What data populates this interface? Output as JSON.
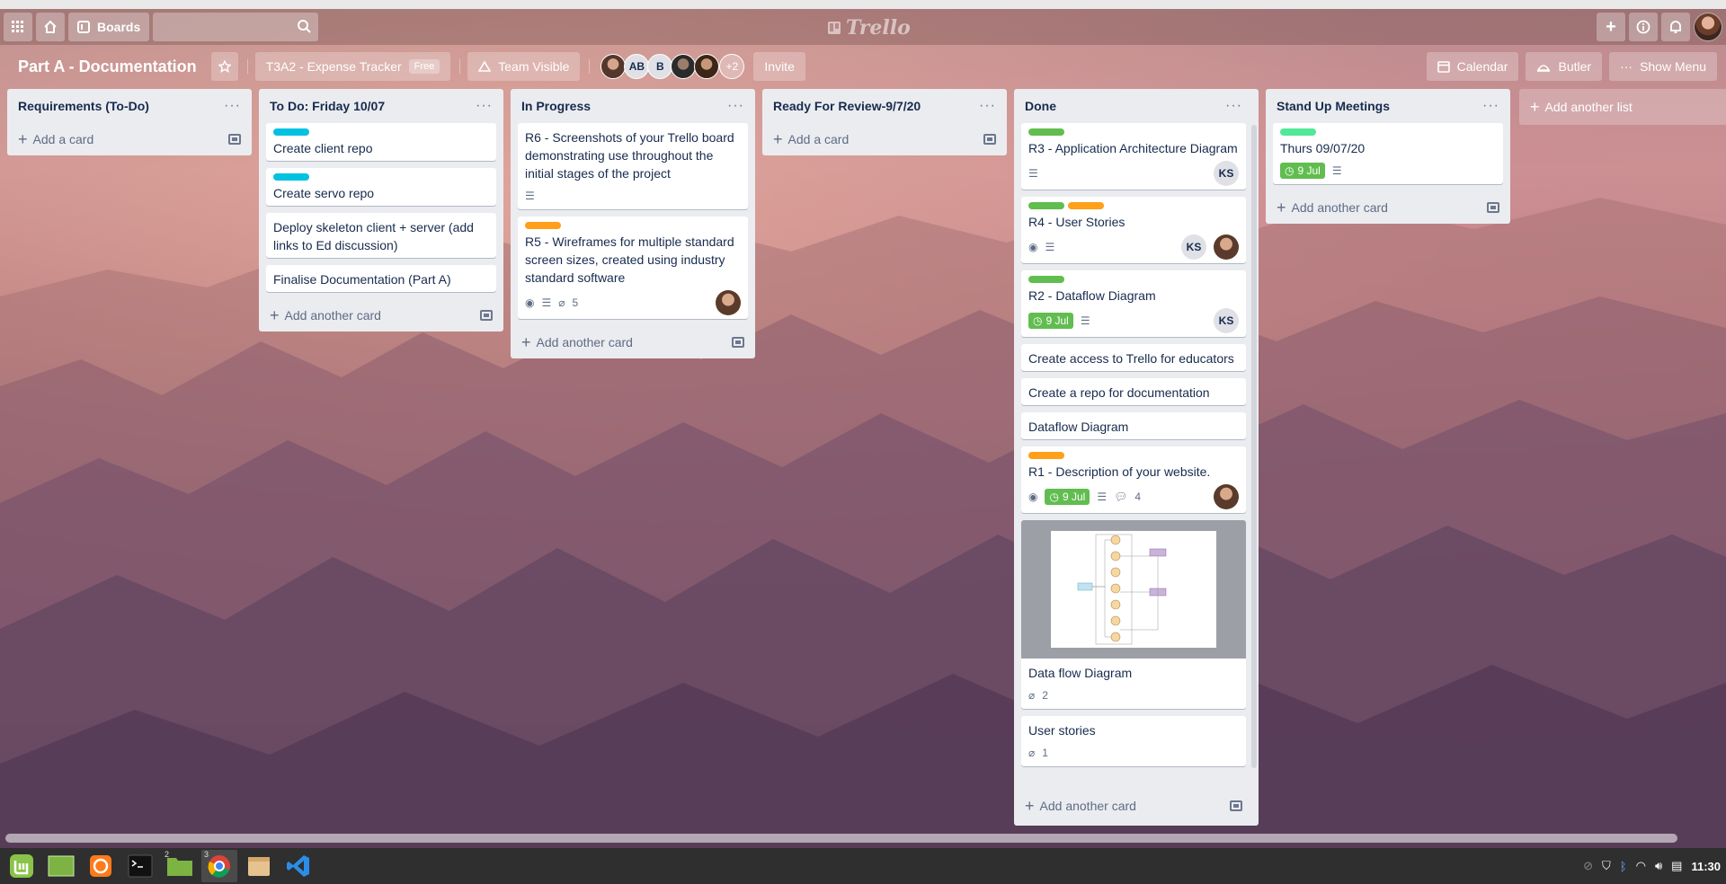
{
  "header": {
    "boards_label": "Boards",
    "logo_text": "Trello"
  },
  "board": {
    "title": "Part A - Documentation",
    "team_name": "T3A2 - Expense Tracker",
    "team_badge": "Free",
    "visibility": "Team Visible",
    "members": [
      "",
      "AB",
      "B",
      "",
      ""
    ],
    "more_members": "+2",
    "invite_label": "Invite",
    "calendar_label": "Calendar",
    "butler_label": "Butler",
    "menu_label": "Show Menu"
  },
  "lists": [
    {
      "title": "Requirements (To-Do)",
      "add_label": "Add a card",
      "cards": []
    },
    {
      "title": "To Do: Friday 10/07",
      "add_label": "Add another card",
      "cards": [
        {
          "title": "Create client repo",
          "labels": [
            "#00c2e0"
          ]
        },
        {
          "title": "Create servo repo",
          "labels": [
            "#00c2e0"
          ]
        },
        {
          "title": "Deploy skeleton client + server (add links to Ed discussion)",
          "labels": []
        },
        {
          "title": "Finalise Documentation (Part A)",
          "labels": []
        }
      ]
    },
    {
      "title": "In Progress",
      "add_label": "Add another card",
      "cards": [
        {
          "title": "R6 - Screenshots of your Trello board demonstrating use throughout the initial stages of the project",
          "labels": []
        },
        {
          "title": "R5 - Wireframes for multiple standard screen sizes, created using industry standard software",
          "labels": [
            "#ff9f1a"
          ],
          "attachments": "5"
        }
      ]
    },
    {
      "title": "Ready For Review-9/7/20",
      "add_label": "Add a card",
      "cards": []
    },
    {
      "title": "Done",
      "add_label": "Add another card",
      "cards": [
        {
          "title": "R3 - Application Architecture Diagram",
          "labels": [
            "#61bd4f"
          ],
          "member": "KS"
        },
        {
          "title": "R4 - User Stories",
          "labels": [
            "#61bd4f",
            "#ff9f1a"
          ],
          "member": "KS"
        },
        {
          "title": "R2 - Dataflow Diagram",
          "labels": [
            "#61bd4f"
          ],
          "due": "9 Jul",
          "member": "KS"
        },
        {
          "title": "Create access to Trello for educators"
        },
        {
          "title": "Create a repo for documentation"
        },
        {
          "title": "Dataflow Diagram"
        },
        {
          "title": "R1 - Description of your website.",
          "labels": [
            "#ff9f1a"
          ],
          "due": "9 Jul",
          "comments": "4"
        },
        {
          "title": "Data flow Diagram",
          "attachments": "2"
        },
        {
          "title": "User stories",
          "attachments": "1"
        }
      ]
    },
    {
      "title": "Stand Up Meetings",
      "add_label": "Add another card",
      "cards": [
        {
          "title": "Thurs 09/07/20",
          "labels": [
            "#51e898"
          ],
          "due": "9 Jul"
        }
      ]
    }
  ],
  "add_list_label": "Add another list",
  "taskbar": {
    "badge_files": "2",
    "badge_chrome": "3",
    "clock": "11:30"
  }
}
